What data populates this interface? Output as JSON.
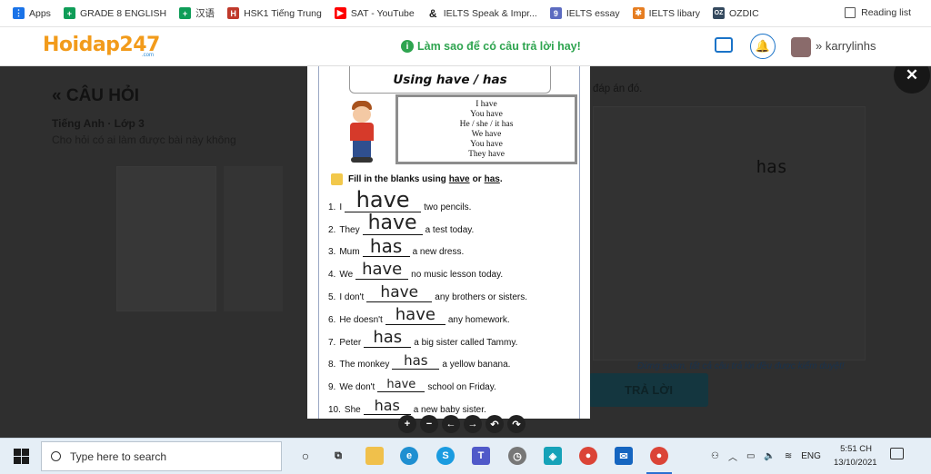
{
  "bookmarks": {
    "items": [
      {
        "label": "Apps",
        "icon": "apps-grid-icon",
        "color": "#1a73e8"
      },
      {
        "label": "GRADE 8 ENGLISH",
        "icon": "google-sheets-icon",
        "color": "#0f9d58"
      },
      {
        "label": "汉语",
        "icon": "google-sheets-icon",
        "color": "#0f9d58"
      },
      {
        "label": "HSK1 Tiếng Trung",
        "icon": "site-icon",
        "color": "#c0392b"
      },
      {
        "label": "SAT - YouTube",
        "icon": "youtube-icon",
        "color": "#ff0000"
      },
      {
        "label": "IELTS Speak & Impr...",
        "icon": "ampersand-icon",
        "color": "#222222"
      },
      {
        "label": "IELTS essay",
        "icon": "site-9-icon",
        "color": "#5c6bc0"
      },
      {
        "label": "IELTS libary",
        "icon": "puzzle-icon",
        "color": "#e67e22"
      },
      {
        "label": "OZDIC",
        "icon": "oz-icon",
        "color": "#34495e"
      }
    ],
    "reading_list": "Reading list"
  },
  "header": {
    "logo": "Hoidap247",
    "logo_sub": ".com",
    "tip": "Làm sao để có câu trả lời hay!",
    "username": "karrylinhs"
  },
  "page": {
    "back_title": "« CÂU HỎI",
    "subject": "Tiếng Anh · Lớp 3",
    "question": "Cho hỏi có ai làm được bài này không",
    "right_note": "đáp án đó.",
    "answer_text": "has",
    "spam_note": "Đừng spam, tất cả câu trả lời đều được kiểm duyệt!",
    "reply_button": "TRẢ LỜI",
    "close_label": "✕"
  },
  "worksheet": {
    "title": "Using have / has",
    "board_lines": [
      "I have",
      "You have",
      "He / she / it has",
      "We have",
      "You have",
      "They have"
    ],
    "instruction_pre": "Fill in the blanks using",
    "instruction_a": "have",
    "instruction_or": "or",
    "instruction_b": "has",
    "sentences": [
      {
        "num": "1.",
        "pre": "I",
        "answer": "have",
        "post": "two pencils."
      },
      {
        "num": "2.",
        "pre": "They",
        "answer": "have",
        "post": "a test today."
      },
      {
        "num": "3.",
        "pre": "Mum",
        "answer": "has",
        "post": "a new dress."
      },
      {
        "num": "4.",
        "pre": "We",
        "answer": "have",
        "post": "no music lesson today."
      },
      {
        "num": "5.",
        "pre": "I don't",
        "answer": "have",
        "post": "any brothers or sisters."
      },
      {
        "num": "6.",
        "pre": "He doesn't",
        "answer": "have",
        "post": "any homework."
      },
      {
        "num": "7.",
        "pre": "Peter",
        "answer": "has",
        "post": "a big sister called Tammy."
      },
      {
        "num": "8.",
        "pre": "The monkey",
        "answer": "has",
        "post": "a yellow banana."
      },
      {
        "num": "9.",
        "pre": "We don't",
        "answer": "have",
        "post": "school on Friday."
      },
      {
        "num": "10.",
        "pre": "She",
        "answer": "has",
        "post": "a new baby sister."
      }
    ]
  },
  "viewer_controls": [
    "+",
    "−",
    "←",
    "→",
    "↶",
    "↷"
  ],
  "taskbar": {
    "search_placeholder": "Type here to search",
    "language": "ENG",
    "time": "5:51 CH",
    "date": "13/10/2021"
  }
}
